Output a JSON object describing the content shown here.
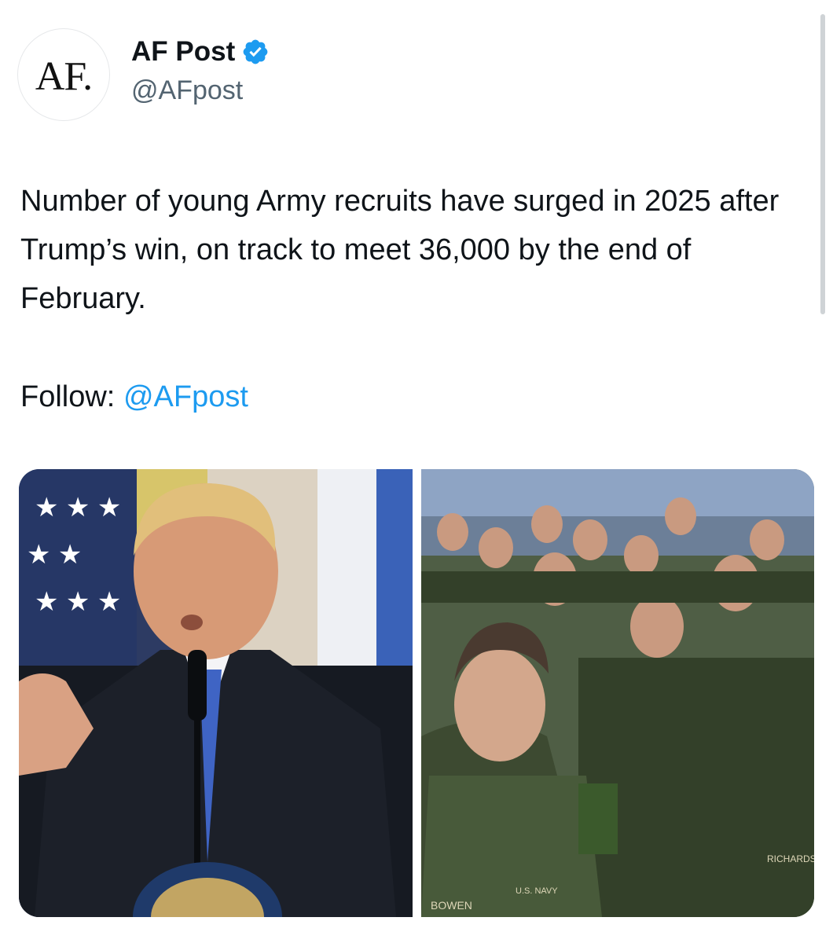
{
  "author": {
    "avatar_text": "AF.",
    "display_name": "AF Post",
    "handle": "@AFpost",
    "verified": true,
    "verified_icon": "verified-badge-icon"
  },
  "tweet": {
    "text": "Number of young Army recruits have surged in 2025 after Trump’s win, on track to meet 36,000 by the end of February.",
    "follow_label": "Follow:",
    "follow_mention": "@AFpost"
  },
  "media": {
    "images": [
      {
        "name": "trump-speaking-photo"
      },
      {
        "name": "navy-recruits-photo",
        "nametape_1": "BOWEN",
        "nametape_2": "RICHARDS",
        "tape_2": "U.S. NAVY"
      }
    ]
  },
  "colors": {
    "link": "#1d9bf0",
    "verified": "#1d9bf0",
    "secondary_text": "#536471",
    "primary_text": "#0f1419"
  }
}
